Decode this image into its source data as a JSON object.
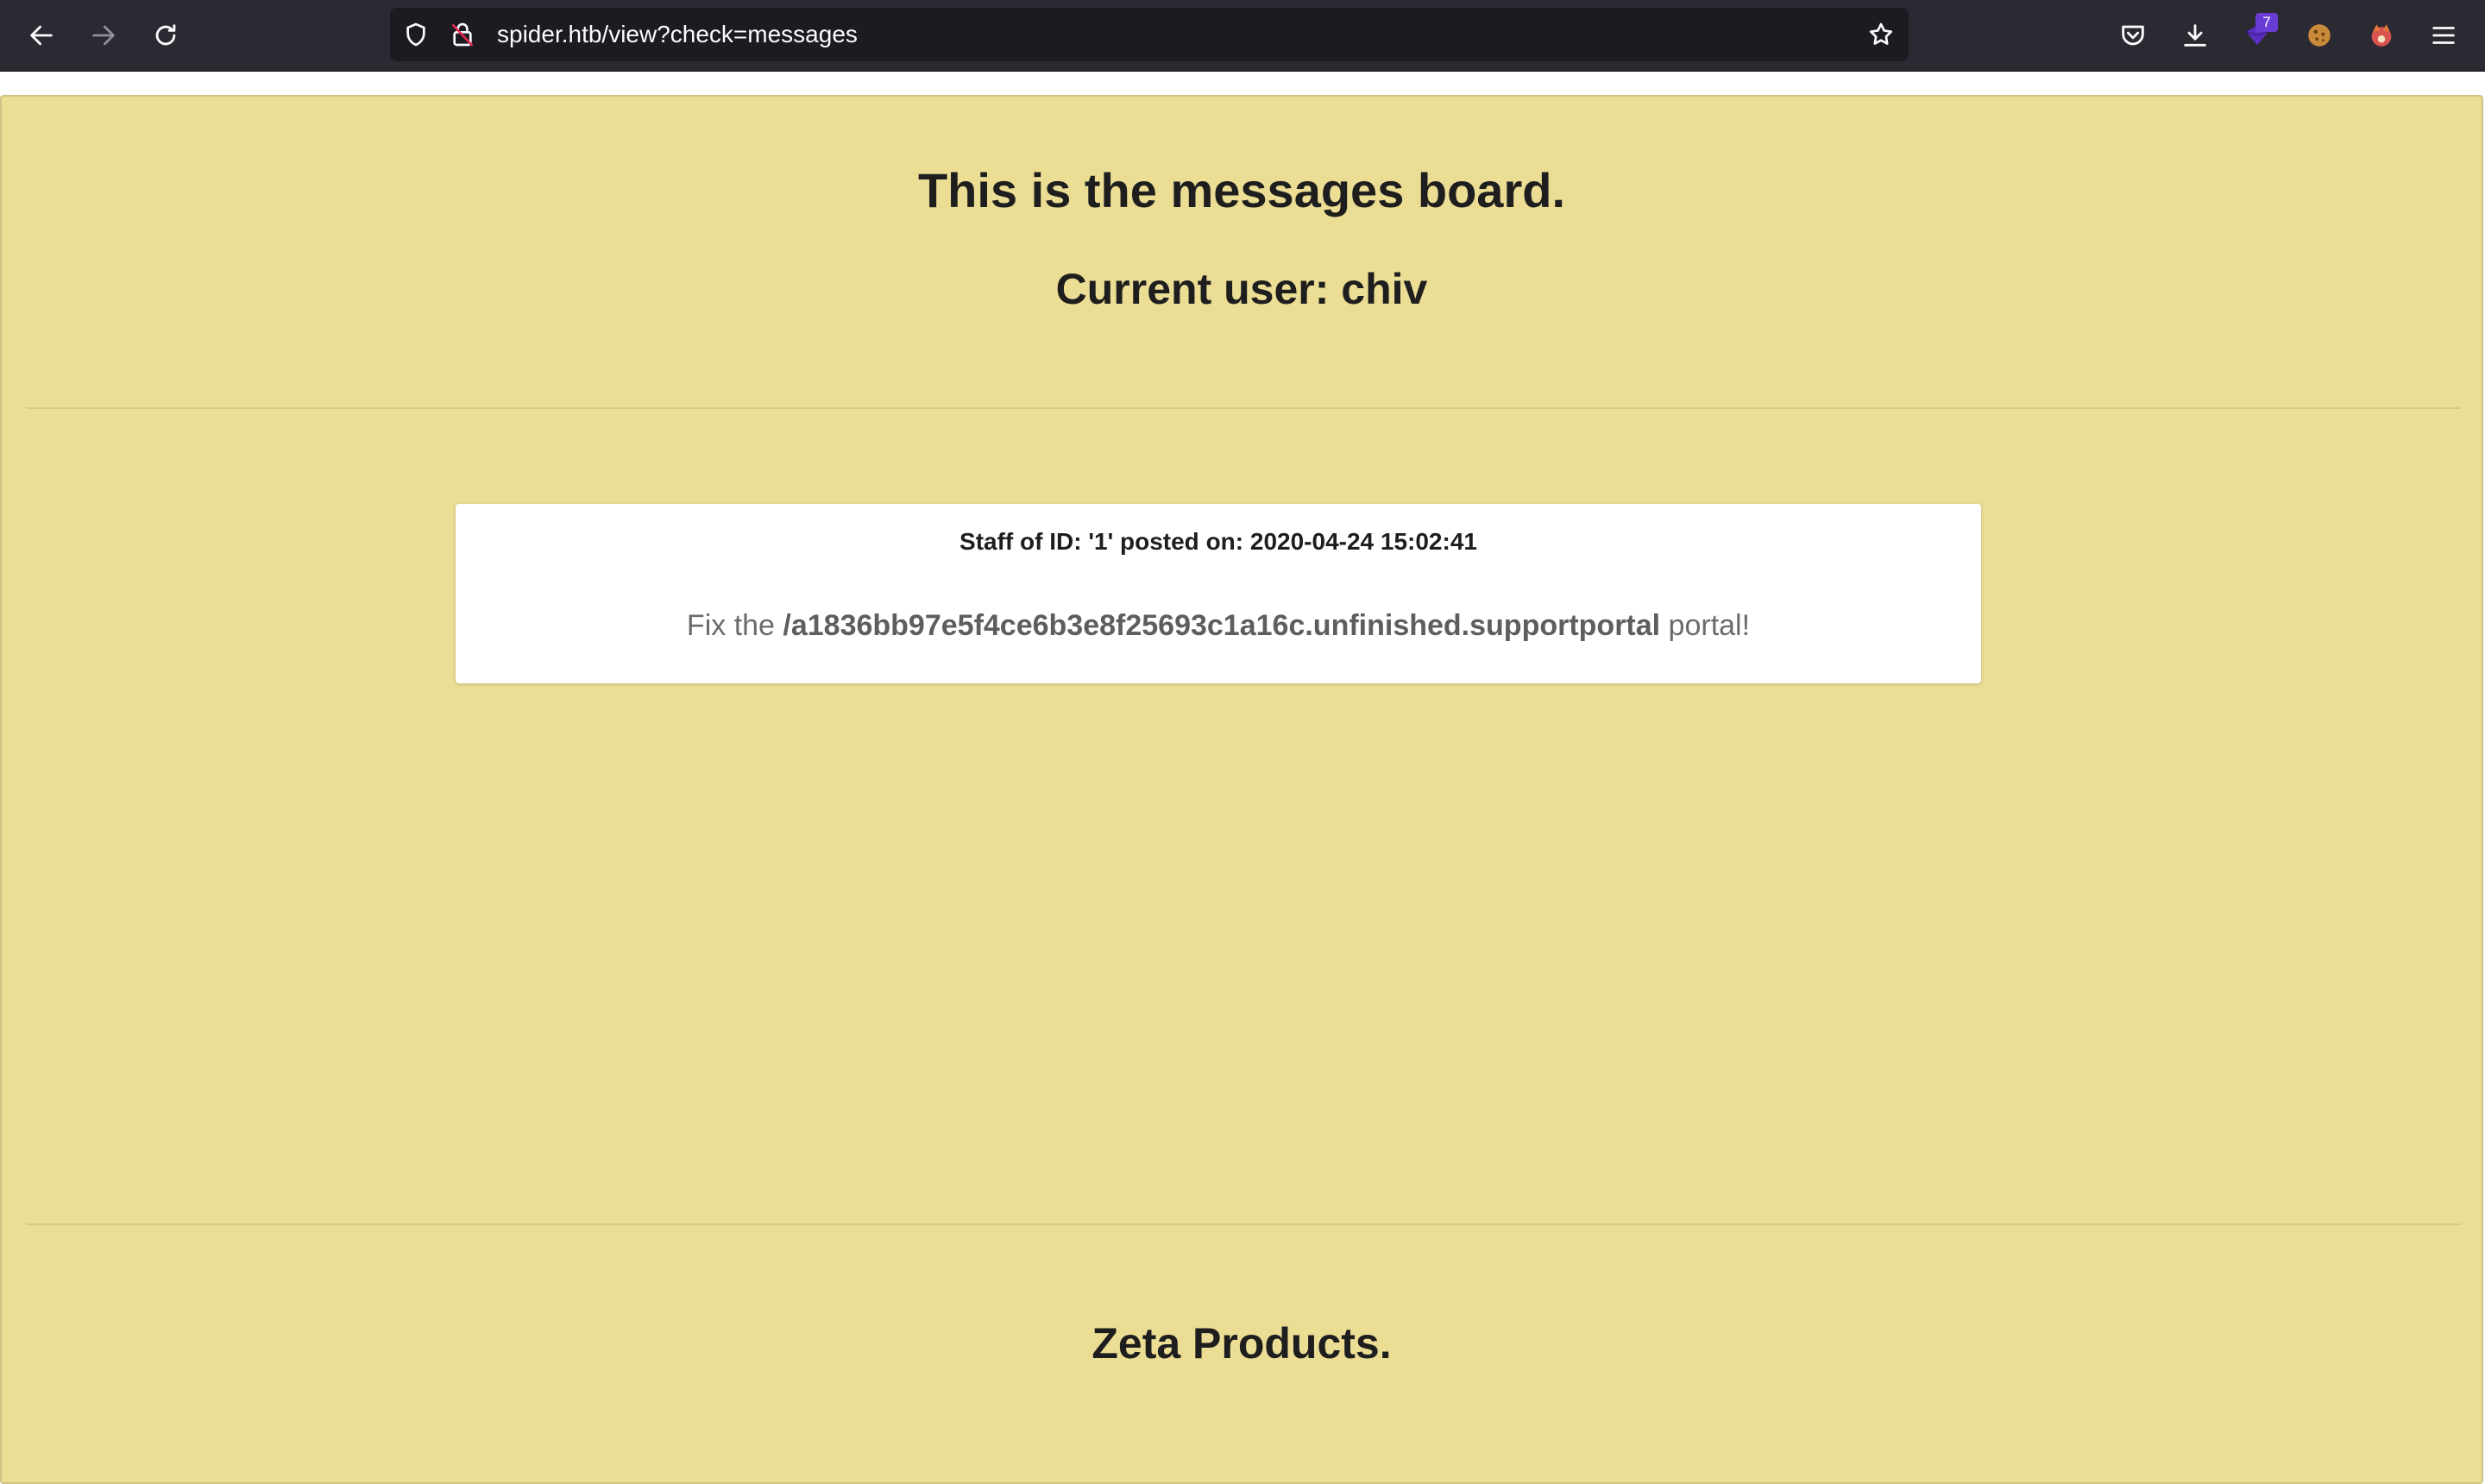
{
  "browser": {
    "url": "spider.htb/view?check=messages",
    "extension_badge": "7",
    "icons": {
      "back": "back-arrow-icon",
      "forward": "forward-arrow-icon",
      "reload": "reload-icon",
      "tracking": "shield-icon",
      "insecure": "insecure-lock-icon",
      "bookmark": "star-icon",
      "pocket": "pocket-icon",
      "downloads": "download-icon",
      "extension": "extension-icon",
      "cookie": "cookie-icon",
      "fox": "foxyproxy-icon",
      "menu": "hamburger-menu-icon"
    }
  },
  "page": {
    "title": "This is the messages board.",
    "current_user": "Current user: chiv",
    "message": {
      "meta": "Staff of ID: '1' posted on: 2020-04-24 15:02:41",
      "body_prefix": "Fix the ",
      "body_path": "/a1836bb97e5f4ce6b3e8f25693c1a16c.unfinished.supportportal",
      "body_suffix": " portal!"
    },
    "footer_title": "Zeta Products."
  },
  "colors": {
    "page_bg": "#ebdd94",
    "toolbar_bg": "#2b2a33",
    "urlbar_bg": "#1c1b22",
    "badge": "#6a3cd6"
  }
}
